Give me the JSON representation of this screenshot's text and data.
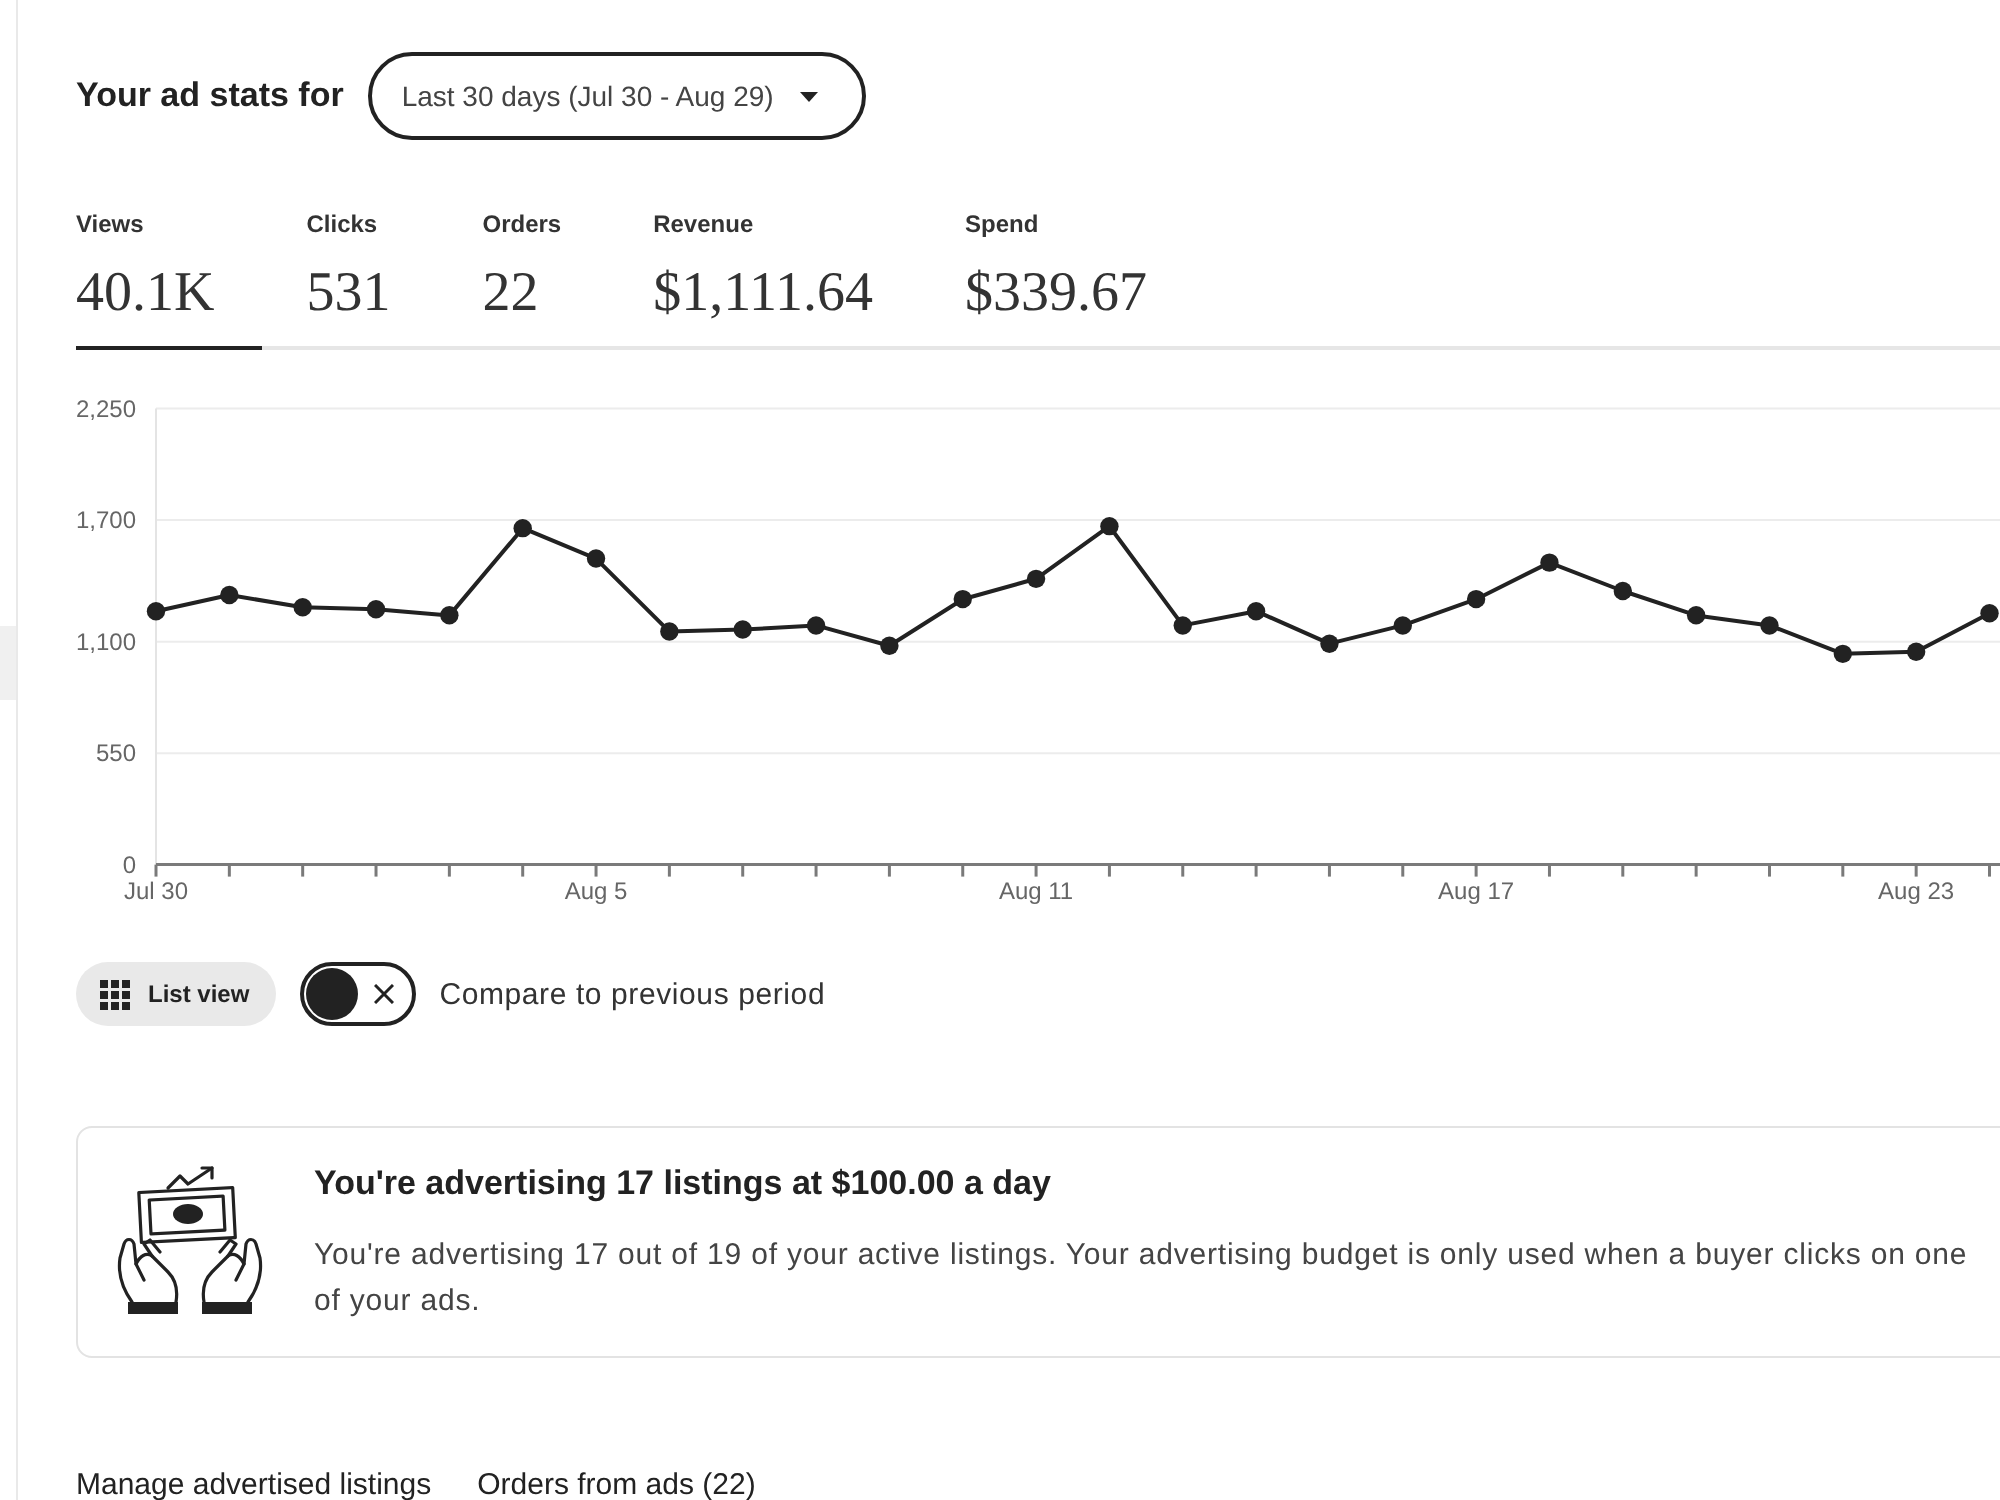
{
  "header": {
    "title": "Your ad stats for",
    "date_range": {
      "value": "Last 30 days (Jul 30 - Aug 29)"
    }
  },
  "metrics": [
    {
      "label": "Views",
      "value": "40.1K",
      "selected": true
    },
    {
      "label": "Clicks",
      "value": "531",
      "selected": false
    },
    {
      "label": "Orders",
      "value": "22",
      "selected": false
    },
    {
      "label": "Revenue",
      "value": "$1,111.64",
      "selected": false
    },
    {
      "label": "Spend",
      "value": "$339.67",
      "selected": false
    }
  ],
  "chart": {
    "chart_data": {
      "type": "line",
      "grid": true,
      "marker": true,
      "categories": [
        "Jul 30",
        null,
        null,
        null,
        null,
        null,
        "Aug 5",
        null,
        null,
        null,
        null,
        null,
        "Aug 11",
        null,
        null,
        null,
        null,
        null,
        "Aug 17",
        null,
        null,
        null,
        null,
        null,
        "Aug 23",
        null
      ],
      "values": [
        1250,
        1330,
        1270,
        1260,
        1230,
        1660,
        1510,
        1150,
        1160,
        1180,
        1080,
        1310,
        1410,
        1670,
        1180,
        1250,
        1090,
        1180,
        1310,
        1490,
        1350,
        1230,
        1180,
        1040,
        1050,
        1240
      ],
      "ylim": [
        0,
        2250
      ],
      "yticks": [
        {
          "value": 0,
          "label": "0"
        },
        {
          "value": 550,
          "label": "550"
        },
        {
          "value": 1100,
          "label": "1,100"
        },
        {
          "value": 1700,
          "label": "1,700"
        },
        {
          "value": 2250,
          "label": "2,250"
        }
      ]
    }
  },
  "controls": {
    "list_view": {
      "label": "List view"
    },
    "compare": {
      "label": "Compare to previous period",
      "on": false
    }
  },
  "summary_card": {
    "title": "You're advertising 17 listings at $100.00 a day",
    "body": "You're advertising 17 out of 19 of your active listings. Your advertising budget is only used when a buyer clicks on one of your ads."
  },
  "tabs": [
    {
      "label": "Manage advertised listings"
    },
    {
      "label": "Orders from ads (22)"
    }
  ]
}
